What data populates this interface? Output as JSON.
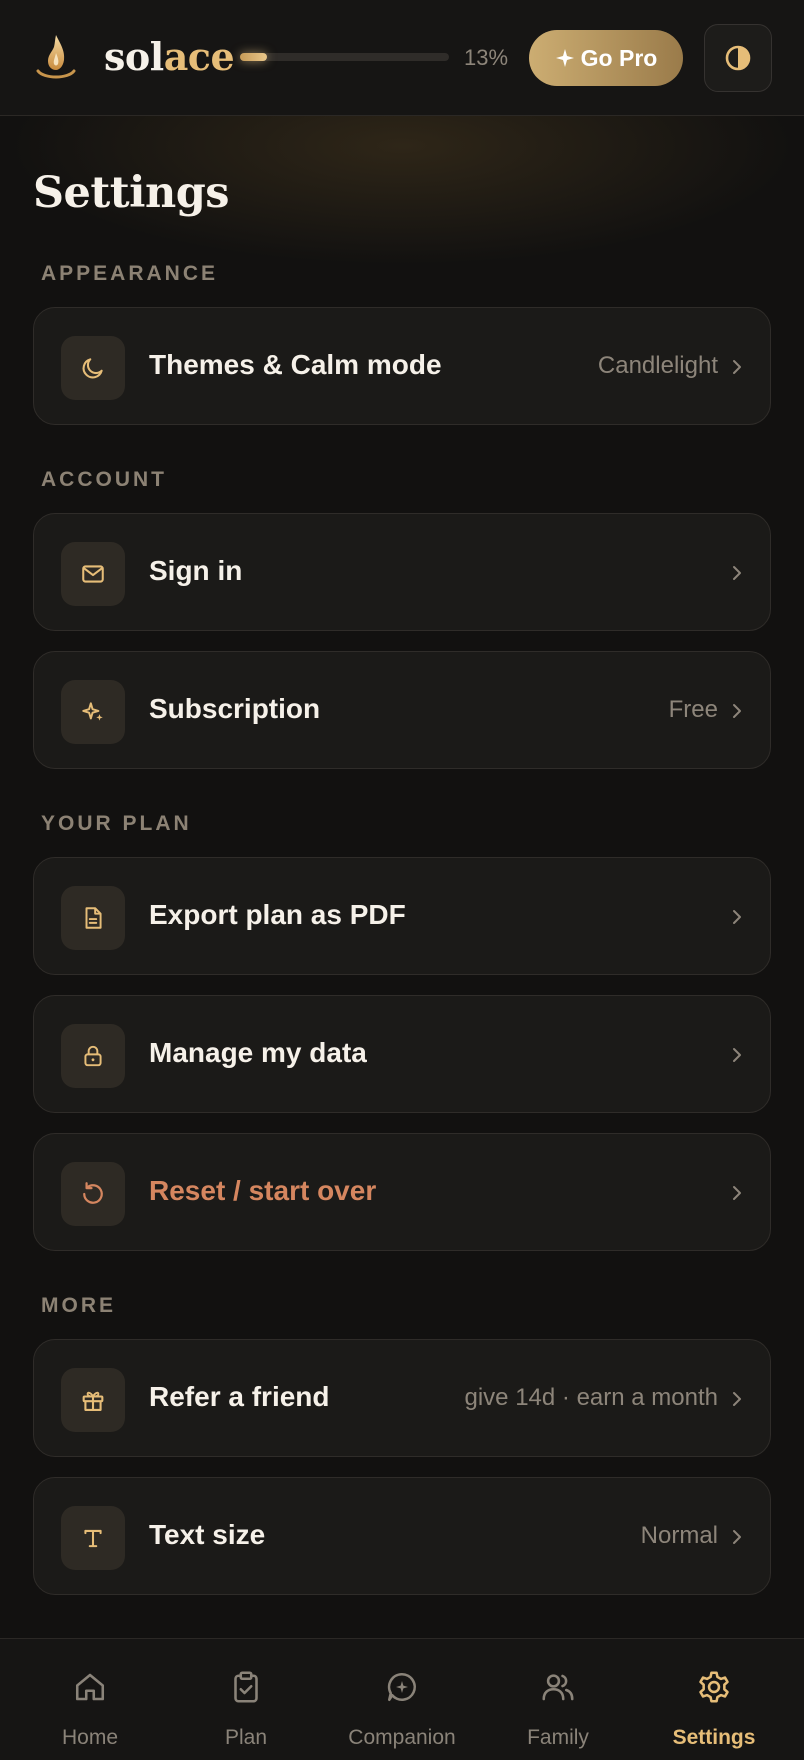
{
  "app": {
    "brand_prefix": "sol",
    "brand_suffix": "ace",
    "progress_percent": 13,
    "progress_text": "13%",
    "go_pro_label": "Go Pro"
  },
  "page": {
    "title": "Settings"
  },
  "sections": {
    "appearance": "APPEARANCE",
    "account": "ACCOUNT",
    "your_plan": "YOUR PLAN",
    "more": "MORE"
  },
  "items": {
    "themes": {
      "label": "Themes & Calm mode",
      "value": "Candlelight"
    },
    "sign_in": {
      "label": "Sign in",
      "value": ""
    },
    "subscription": {
      "label": "Subscription",
      "value": "Free"
    },
    "export_pdf": {
      "label": "Export plan as PDF",
      "value": ""
    },
    "manage_data": {
      "label": "Manage my data",
      "value": ""
    },
    "reset": {
      "label": "Reset / start over",
      "value": ""
    },
    "refer": {
      "label": "Refer a friend",
      "value": "give 14d · earn a month"
    },
    "text_size": {
      "label": "Text size",
      "value": "Normal"
    }
  },
  "nav": [
    {
      "label": "Home",
      "icon": "home-icon"
    },
    {
      "label": "Plan",
      "icon": "clipboard-icon"
    },
    {
      "label": "Companion",
      "icon": "chat-sparkle-icon"
    },
    {
      "label": "Family",
      "icon": "users-icon"
    },
    {
      "label": "Settings",
      "icon": "gear-icon",
      "active": true
    }
  ],
  "colors": {
    "accent": "#e6bd78",
    "background": "#121110",
    "card": "#1b1a18",
    "danger": "#d5865f",
    "muted": "#8d857a"
  }
}
